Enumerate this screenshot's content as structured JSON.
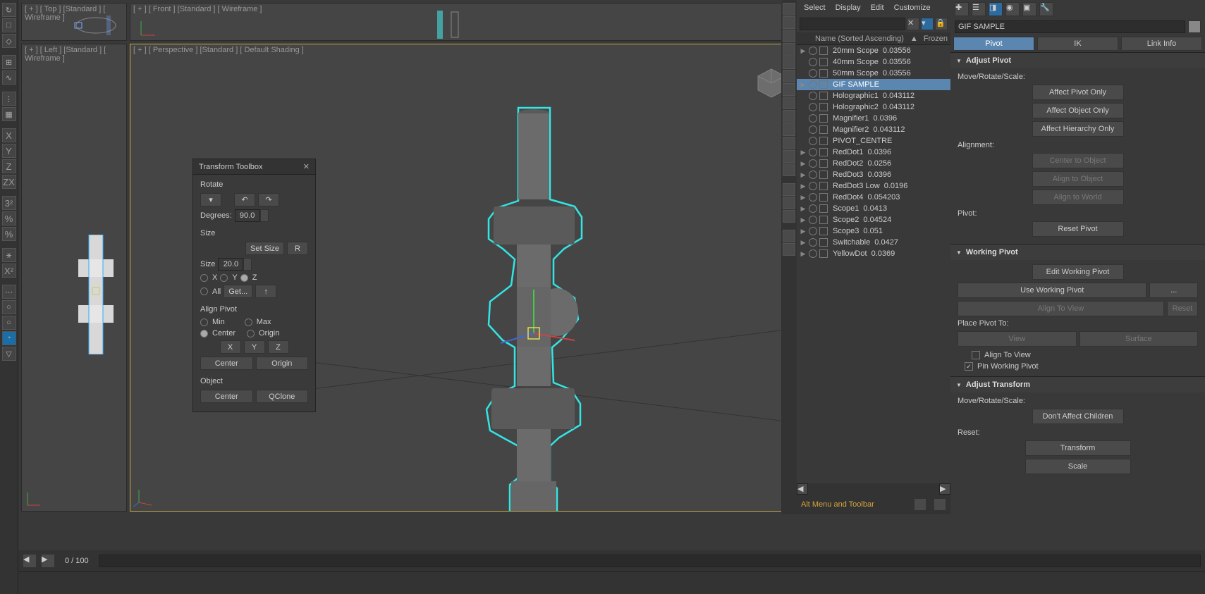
{
  "viewports": {
    "tl": "[ + ] [ Top ] [Standard ] [ Wireframe ]",
    "tr": "[ + ] [ Front ] [Standard ] [ Wireframe ]",
    "bl": "[ + ] [ Left ] [Standard ] [ Wireframe ]",
    "br": "[ + ] [ Perspective ] [Standard ] [ Default Shading ]"
  },
  "left_axes": [
    "X",
    "Y",
    "Z",
    "ZX",
    "3²",
    "%",
    "%",
    "⚹",
    "X²"
  ],
  "toolbox": {
    "title": "Transform Toolbox",
    "rotate": {
      "label": "Rotate",
      "degrees_label": "Degrees:",
      "degrees": "90.0"
    },
    "size": {
      "label": "Size",
      "set": "Set Size",
      "r": "R",
      "sizelab": "Size",
      "size": "20.0",
      "x": "X",
      "y": "Y",
      "z": "Z",
      "all": "All",
      "get": "Get..."
    },
    "align_pivot": {
      "label": "Align Pivot",
      "min": "Min",
      "max": "Max",
      "center": "Center",
      "origin": "Origin",
      "x": "X",
      "y": "Y",
      "z": "Z",
      "center_btn": "Center",
      "origin_btn": "Origin"
    },
    "object": {
      "label": "Object",
      "center": "Center",
      "qclone": "QClone"
    }
  },
  "outliner": {
    "tabs": [
      "Select",
      "Display",
      "Edit",
      "Customize"
    ],
    "header": "Name (Sorted Ascending)",
    "frozen": "Frozen",
    "rows": [
      {
        "name": "20mm Scope",
        "val": "0.03556",
        "sel": false,
        "tog": "▶"
      },
      {
        "name": "40mm Scope",
        "val": "0.03556",
        "sel": false,
        "tog": ""
      },
      {
        "name": "50mm Scope",
        "val": "0.03556",
        "sel": false,
        "tog": ""
      },
      {
        "name": "GIF SAMPLE",
        "val": "",
        "sel": true,
        "tog": "▶"
      },
      {
        "name": "Holographic1",
        "val": "0.043112",
        "sel": false,
        "tog": ""
      },
      {
        "name": "Holographic2",
        "val": "0.043112",
        "sel": false,
        "tog": ""
      },
      {
        "name": "Magnifier1",
        "val": "0.0396",
        "sel": false,
        "tog": ""
      },
      {
        "name": "Magnifier2",
        "val": "0.043112",
        "sel": false,
        "tog": ""
      },
      {
        "name": "PIVOT_CENTRE",
        "val": "",
        "sel": false,
        "tog": ""
      },
      {
        "name": "RedDot1",
        "val": "0.0396",
        "sel": false,
        "tog": "▶"
      },
      {
        "name": "RedDot2",
        "val": "0.0256",
        "sel": false,
        "tog": "▶"
      },
      {
        "name": "RedDot3",
        "val": "0.0396",
        "sel": false,
        "tog": "▶"
      },
      {
        "name": "RedDot3 Low",
        "val": "0.0196",
        "sel": false,
        "tog": "▶"
      },
      {
        "name": "RedDot4",
        "val": "0.054203",
        "sel": false,
        "tog": "▶"
      },
      {
        "name": "Scope1",
        "val": "0.0413",
        "sel": false,
        "tog": "▶"
      },
      {
        "name": "Scope2",
        "val": "0.04524",
        "sel": false,
        "tog": "▶"
      },
      {
        "name": "Scope3",
        "val": "0.051",
        "sel": false,
        "tog": "▶"
      },
      {
        "name": "Switchable",
        "val": "0.0427",
        "sel": false,
        "tog": "▶"
      },
      {
        "name": "YellowDot",
        "val": "0.0369",
        "sel": false,
        "tog": "▶"
      }
    ],
    "bottombar": "Alt Menu and Toolbar"
  },
  "panel": {
    "name": "GIF SAMPLE",
    "tabs": {
      "pivot": "Pivot",
      "ik": "IK",
      "link": "Link Info"
    },
    "adjust_pivot": {
      "title": "Adjust Pivot",
      "mrs": "Move/Rotate/Scale:",
      "apo": "Affect Pivot Only",
      "aoo": "Affect Object Only",
      "aho": "Affect Hierarchy Only",
      "alignment": "Alignment:",
      "cto": "Center to Object",
      "ato": "Align to Object",
      "atw": "Align to World",
      "pivot": "Pivot:",
      "reset": "Reset Pivot"
    },
    "working_pivot": {
      "title": "Working Pivot",
      "ewp": "Edit Working Pivot",
      "uwp": "Use Working Pivot",
      "dots": "...",
      "atv": "Align To View",
      "resetb": "Reset",
      "ppt": "Place Pivot To:",
      "view": "View",
      "surface": "Surface",
      "atv2": "Align To View",
      "pin": "Pin Working Pivot"
    },
    "adjust_transform": {
      "title": "Adjust Transform",
      "mrs": "Move/Rotate/Scale:",
      "dac": "Don't Affect Children",
      "reset": "Reset:",
      "transform": "Transform",
      "scale": "Scale"
    }
  },
  "timeline": {
    "frame": "0 / 100"
  }
}
